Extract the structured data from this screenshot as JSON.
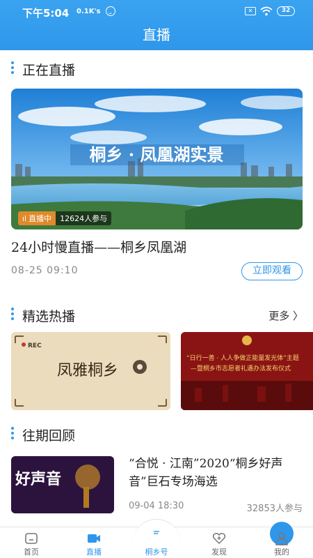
{
  "status_bar": {
    "time": "下午5:04",
    "speed": "0.1K's",
    "sim": "✕",
    "battery": "32"
  },
  "header": {
    "title": "直播"
  },
  "live_section": {
    "title": "正在直播",
    "banner_text": "桐乡 · 凤凰湖实景",
    "badge_status": "直播中",
    "badge_count": "12624人参与",
    "stream_title": "24小时慢直播——桐乡凤凰湖",
    "date": "08-25 09:10",
    "watch_button": "立即观看"
  },
  "hot_section": {
    "title": "精选热播",
    "more": "更多 〉",
    "cards": [
      {
        "rec_label": "REC",
        "title_text": "凤雅桐乡"
      },
      {
        "title_text": "“日行一善 · 人人争做正能量发光体”主题",
        "subtitle_text": "—暨桐乡市志愿者礼遇办法发布仪式"
      }
    ]
  },
  "review_section": {
    "title": "往期回顾",
    "items": [
      {
        "thumb_text": "好声音",
        "title": "“合悦 · 江南”2020“桐乡好声音”巨石专场海选",
        "date": "09-04 18:30",
        "count": "32853人参与"
      }
    ]
  },
  "bottom_nav": {
    "items": [
      {
        "label": "首页",
        "icon": "home-icon"
      },
      {
        "label": "直播",
        "icon": "video-icon"
      },
      {
        "label": "桐乡号",
        "icon": "tongxiang-icon"
      },
      {
        "label": "发现",
        "icon": "discover-icon"
      },
      {
        "label": "我的",
        "icon": "user-icon"
      }
    ]
  },
  "colors": {
    "accent": "#2f97ea",
    "badge": "#e08a2b"
  }
}
